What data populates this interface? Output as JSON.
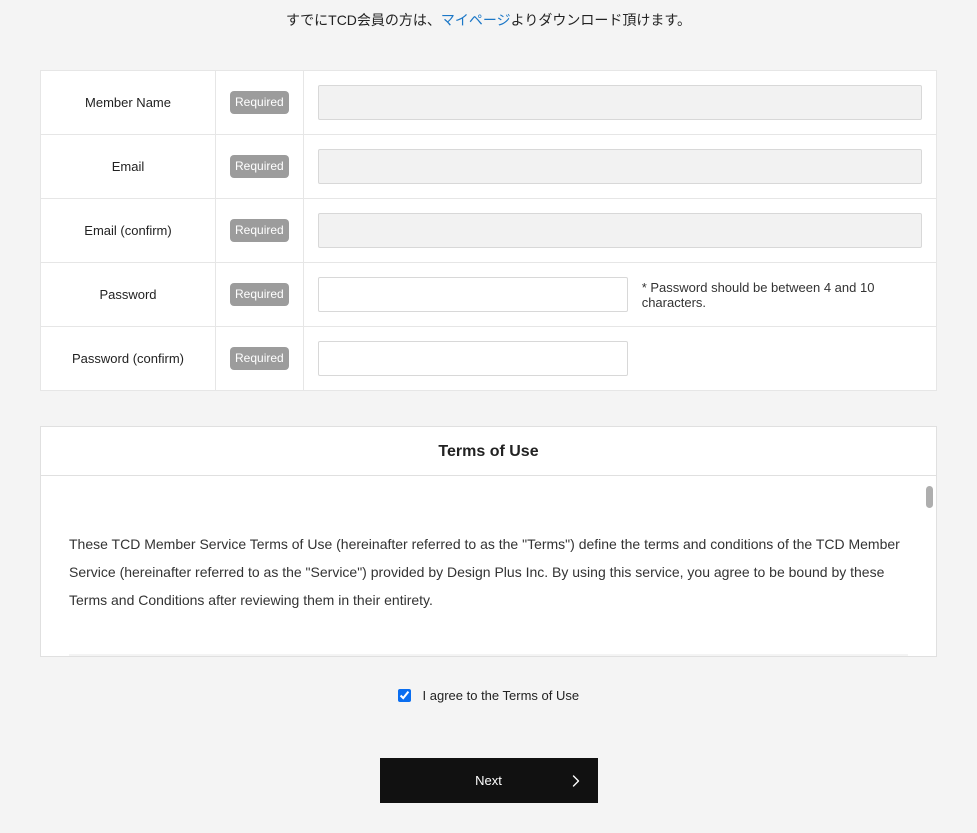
{
  "intro": {
    "before": "すでにTCD会員の方は、",
    "link": "マイページ",
    "after": "よりダウンロード頂けます。"
  },
  "required_label": "Required",
  "fields": {
    "member_name": {
      "label": "Member Name"
    },
    "email": {
      "label": "Email"
    },
    "email_confirm": {
      "label": "Email (confirm)"
    },
    "password": {
      "label": "Password",
      "note": "* Password should be between 4 and 10 characters."
    },
    "password_confirm": {
      "label": "Password (confirm)"
    }
  },
  "terms": {
    "heading": "Terms of Use",
    "body": "These TCD Member Service Terms of Use (hereinafter referred to as the \"Terms\") define the terms and conditions of the TCD Member Service (hereinafter referred to as the \"Service\") provided by Design Plus Inc. By using this service, you agree to be bound by these Terms and Conditions after reviewing them in their entirety."
  },
  "agree_label": "I agree to the Terms of Use",
  "agree_checked": true,
  "next_label": "Next"
}
